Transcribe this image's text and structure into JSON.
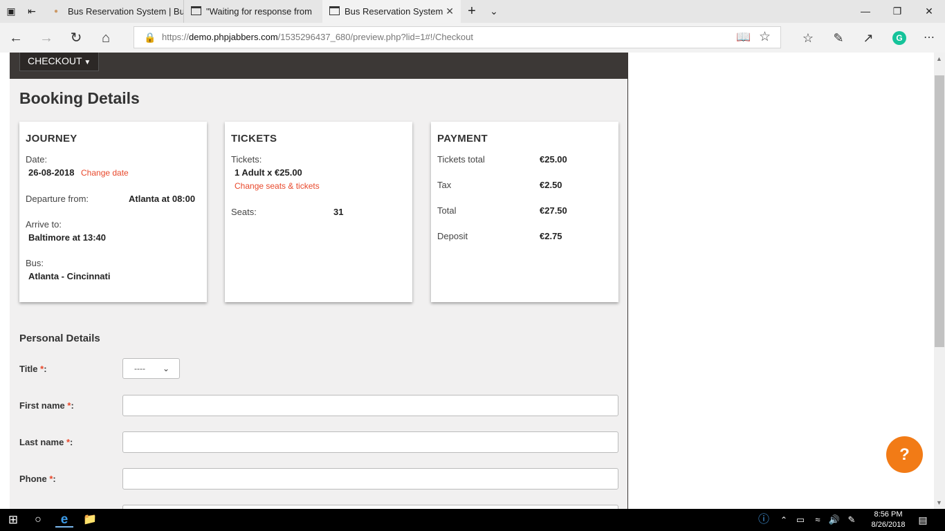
{
  "browser": {
    "tabs": [
      {
        "title": "Bus Reservation System | Bu"
      },
      {
        "title": "\"Waiting for response from"
      },
      {
        "title": "Bus Reservation System"
      }
    ],
    "url": {
      "prefix": "https://",
      "host": "demo.phpjabbers.com",
      "path": "/1535296437_680/preview.php?lid=1#!/Checkout"
    }
  },
  "header": {
    "checkout_label": "CHECKOUT"
  },
  "booking": {
    "title": "Booking Details",
    "journey": {
      "heading": "JOURNEY",
      "date_label": "Date:",
      "date_value": "26-08-2018",
      "change_date": "Change date",
      "departure_label": "Departure from:",
      "departure_value": "Atlanta at 08:00",
      "arrive_label": "Arrive to:",
      "arrive_value": "Baltimore at 13:40",
      "bus_label": "Bus:",
      "bus_value": "Atlanta - Cincinnati"
    },
    "tickets": {
      "heading": "TICKETS",
      "tickets_label": "Tickets:",
      "tickets_value": "1 Adult x €25.00",
      "change_link": "Change seats & tickets",
      "seats_label": "Seats:",
      "seats_value": "31"
    },
    "payment": {
      "heading": "PAYMENT",
      "rows": [
        {
          "label": "Tickets total",
          "value": "€25.00"
        },
        {
          "label": "Tax",
          "value": "€2.50"
        },
        {
          "label": "Total",
          "value": "€27.50"
        },
        {
          "label": "Deposit",
          "value": "€2.75"
        }
      ]
    }
  },
  "personal": {
    "title": "Personal Details",
    "title_label": "Title",
    "title_selected": "----",
    "first_name_label": "First name",
    "last_name_label": "Last name",
    "phone_label": "Phone",
    "required_mark": "*",
    "colon": ":"
  },
  "help": {
    "label": "?"
  },
  "taskbar": {
    "time": "8:56 PM",
    "date": "8/26/2018"
  },
  "colors": {
    "accent": "#e8472a",
    "help_button": "#f27b16",
    "header_dark": "#3c3836"
  }
}
